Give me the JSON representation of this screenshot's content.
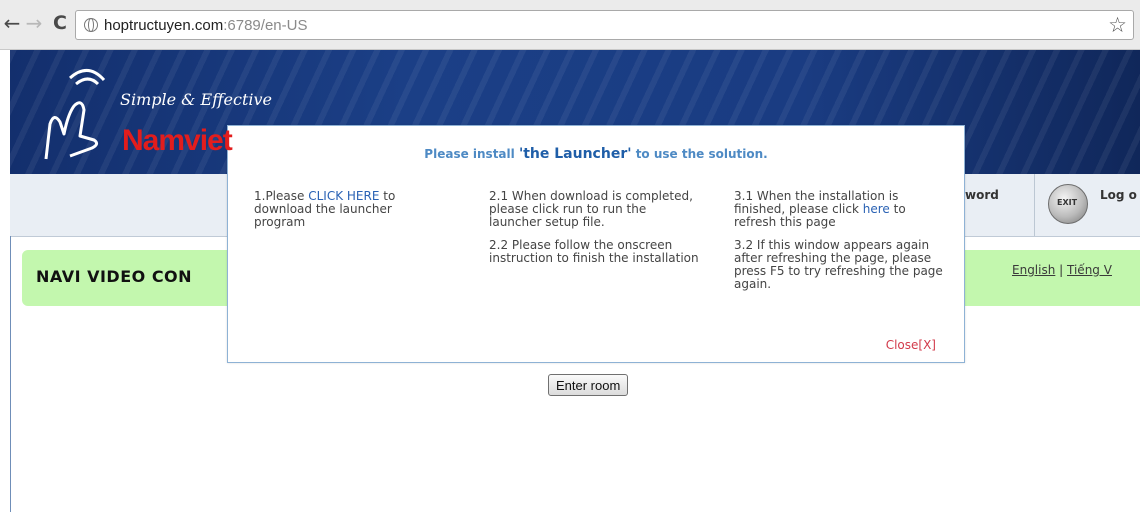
{
  "browser": {
    "url_host": "hoptructuyen.com",
    "url_path": ":6789/en-US",
    "back_icon": "back-arrow-icon",
    "forward_icon": "forward-arrow-icon",
    "reload_icon": "reload-icon",
    "bookmark_icon": "star-icon"
  },
  "header": {
    "tagline": "Simple & Effective",
    "brand": "Namviet",
    "nav_password": "word",
    "nav_logout": "Log o",
    "logout_icon_text": "EXIT",
    "accent_color": "#1b3f86"
  },
  "page": {
    "title": "NAVI VIDEO CON",
    "lang_english": "English",
    "lang_sep": " | ",
    "lang_viet": "Tiếng V",
    "enter_button": "Enter room"
  },
  "popup": {
    "title_pre": "Please install ",
    "title_highlight": "'the Launcher'",
    "title_post": " to use the solution.",
    "col1_pre": "1.Please ",
    "col1_link": "CLICK HERE",
    "col1_post": " to download the launcher program",
    "col2_p1": "2.1 When download is completed, please click run to run the launcher setup file.",
    "col2_p2": "2.2 Please follow the onscreen instruction to finish the installation",
    "col3_p1_pre": "3.1 When the installation is finished, please click ",
    "col3_p1_link": "here",
    "col3_p1_post": " to refresh this page",
    "col3_p2": "3.2 If this window appears again after refreshing the page, please press F5 to try refreshing the page again.",
    "close": "Close[X]"
  }
}
